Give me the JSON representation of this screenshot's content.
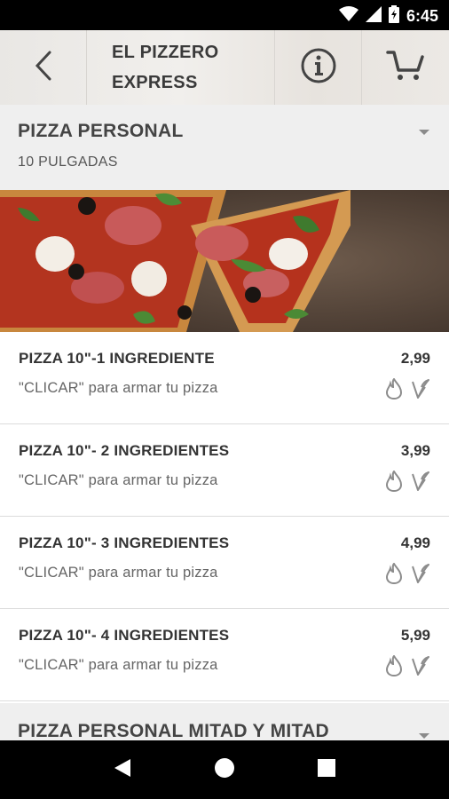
{
  "status_bar": {
    "time": "6:45",
    "icons": [
      "wifi-icon",
      "signal-icon",
      "battery-icon"
    ]
  },
  "header": {
    "title_line1": "EL PIZZERO",
    "title_line2": "EXPRESS",
    "icons": [
      "back-arrow-icon",
      "info-icon",
      "cart-icon"
    ]
  },
  "sections": [
    {
      "title": "PIZZA PERSONAL",
      "subtitle": "10 PULGADAS",
      "items": [
        {
          "name": "PIZZA 10\"-1 INGREDIENTE",
          "price": "2,99",
          "description": "\"CLICAR\" para armar tu pizza",
          "icons": [
            "spicy-icon",
            "vegetarian-icon"
          ]
        },
        {
          "name": "PIZZA 10\"- 2 INGREDIENTES",
          "price": "3,99",
          "description": "\"CLICAR\" para armar tu pizza",
          "icons": [
            "spicy-icon",
            "vegetarian-icon"
          ]
        },
        {
          "name": "PIZZA 10\"- 3 INGREDIENTES",
          "price": "4,99",
          "description": "\"CLICAR\" para armar tu pizza",
          "icons": [
            "spicy-icon",
            "vegetarian-icon"
          ]
        },
        {
          "name": "PIZZA 10\"- 4 INGREDIENTES",
          "price": "5,99",
          "description": "\"CLICAR\" para armar tu pizza",
          "icons": [
            "spicy-icon",
            "vegetarian-icon"
          ]
        }
      ]
    },
    {
      "title": "PIZZA PERSONAL MITAD Y MITAD"
    }
  ],
  "nav_bar": {
    "icons": [
      "nav-back-icon",
      "nav-home-icon",
      "nav-recents-icon"
    ]
  }
}
